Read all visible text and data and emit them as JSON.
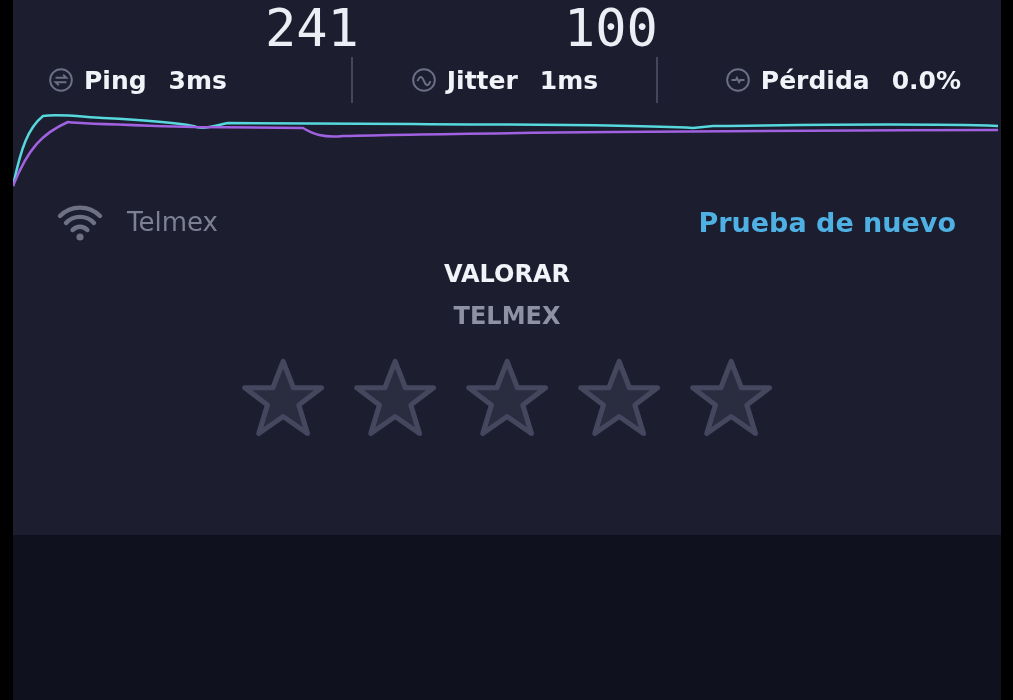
{
  "speeds": [
    "241",
    "100"
  ],
  "metrics": [
    {
      "kind": "ping",
      "label": "Ping",
      "value": "3ms"
    },
    {
      "kind": "jitter",
      "label": "Jitter",
      "value": "1ms"
    },
    {
      "kind": "loss",
      "label": "Pérdida",
      "value": "0.0%"
    }
  ],
  "provider": {
    "name": "Telmex",
    "action": "Prueba de nuevo"
  },
  "rating": {
    "title": "VALORAR",
    "subtitle": "TELMEX",
    "stars": 0
  }
}
